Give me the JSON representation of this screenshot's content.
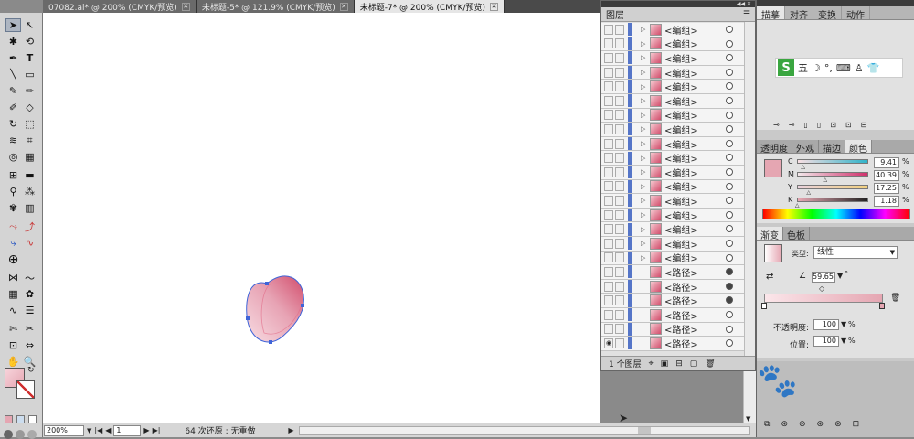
{
  "tabs": [
    {
      "label": "07082.ai* @ 200% (CMYK/预览)",
      "active": false
    },
    {
      "label": "未标题-5* @ 121.9% (CMYK/预览)",
      "active": false
    },
    {
      "label": "未标题-7* @ 200% (CMYK/预览)",
      "active": true
    }
  ],
  "status": {
    "zoom": "200%",
    "page": "1",
    "history": "64 次还原 : 无重做"
  },
  "layers": {
    "title": "图层",
    "rows": [
      {
        "name": "<编组>",
        "eye": false,
        "filled": false
      },
      {
        "name": "<编组>",
        "eye": false,
        "filled": false
      },
      {
        "name": "<编组>",
        "eye": false,
        "filled": false
      },
      {
        "name": "<编组>",
        "eye": false,
        "filled": false
      },
      {
        "name": "<编组>",
        "eye": false,
        "filled": false
      },
      {
        "name": "<编组>",
        "eye": false,
        "filled": false
      },
      {
        "name": "<编组>",
        "eye": false,
        "filled": false
      },
      {
        "name": "<编组>",
        "eye": false,
        "filled": false
      },
      {
        "name": "<编组>",
        "eye": false,
        "filled": false
      },
      {
        "name": "<编组>",
        "eye": false,
        "filled": false
      },
      {
        "name": "<编组>",
        "eye": false,
        "filled": false
      },
      {
        "name": "<编组>",
        "eye": false,
        "filled": false
      },
      {
        "name": "<编组>",
        "eye": false,
        "filled": false
      },
      {
        "name": "<编组>",
        "eye": false,
        "filled": false
      },
      {
        "name": "<编组>",
        "eye": false,
        "filled": false
      },
      {
        "name": "<编组>",
        "eye": false,
        "filled": false
      },
      {
        "name": "<编组>",
        "eye": false,
        "filled": false
      },
      {
        "name": "<路径>",
        "eye": false,
        "filled": true
      },
      {
        "name": "<路径>",
        "eye": false,
        "filled": true
      },
      {
        "name": "<路径>",
        "eye": false,
        "filled": true
      },
      {
        "name": "<路径>",
        "eye": false,
        "filled": false
      },
      {
        "name": "<路径>",
        "eye": false,
        "filled": false
      },
      {
        "name": "<路径>",
        "eye": true,
        "filled": false
      }
    ],
    "footer": "1 个图层"
  },
  "right": {
    "top_tabs": [
      "描摹",
      "对齐",
      "变换",
      "动作"
    ],
    "color_tabs": [
      "透明度",
      "外观",
      "描边",
      "颜色"
    ],
    "cmyk": [
      {
        "label": "C",
        "value": "9.41",
        "unit": "%",
        "level": 0.094
      },
      {
        "label": "M",
        "value": "40.39",
        "unit": "%",
        "level": 0.404
      },
      {
        "label": "Y",
        "value": "17.25",
        "unit": "%",
        "level": 0.172
      },
      {
        "label": "K",
        "value": "1.18",
        "unit": "%",
        "level": 0.012
      }
    ],
    "gradient_tabs": [
      "渐变",
      "色板"
    ],
    "type_label": "类型:",
    "type_value": "线性",
    "angle_value": "59.65",
    "angle_unit": "°",
    "opacity_label": "不透明度:",
    "opacity_value": "100",
    "position_label": "位置:",
    "position_value": "100",
    "percent": "%",
    "ime_letter": "五"
  },
  "colors": {
    "fill": "#e5a6b2",
    "accent": "#d24d6c"
  }
}
